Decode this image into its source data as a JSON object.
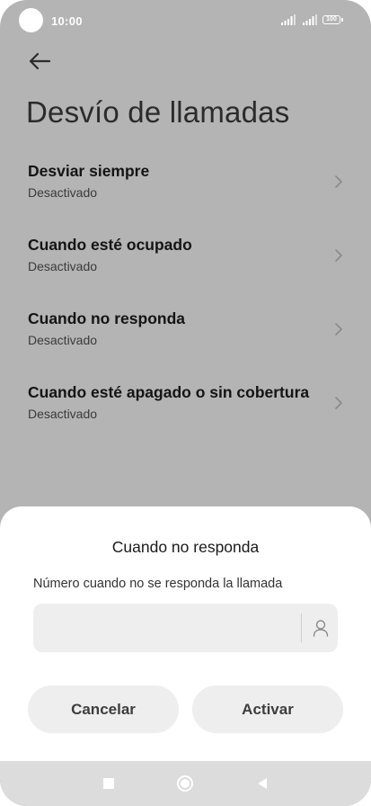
{
  "status_bar": {
    "time": "10:00",
    "battery": "100",
    "icons": [
      "signal-icon",
      "signal-icon",
      "battery-icon"
    ]
  },
  "header": {
    "back_icon": "back-arrow-icon",
    "title": "Desvío de llamadas"
  },
  "settings": [
    {
      "title": "Desviar siempre",
      "status": "Desactivado"
    },
    {
      "title": "Cuando esté ocupado",
      "status": "Desactivado"
    },
    {
      "title": "Cuando no responda",
      "status": "Desactivado"
    },
    {
      "title": "Cuando esté apagado o sin cobertura",
      "status": "Desactivado"
    }
  ],
  "dialog": {
    "title": "Cuando no responda",
    "description": "Número cuando no se responda la llamada",
    "input_value": "",
    "contact_icon": "contact-icon",
    "cancel_label": "Cancelar",
    "activate_label": "Activar"
  },
  "nav_bar": {
    "icons": [
      "recents-icon",
      "home-icon",
      "back-icon"
    ]
  },
  "colors": {
    "overlay_background": "#b4b4b4",
    "sheet_background": "#ffffff",
    "button_background": "#eeeeee",
    "nav_background": "#dcdcdc"
  }
}
